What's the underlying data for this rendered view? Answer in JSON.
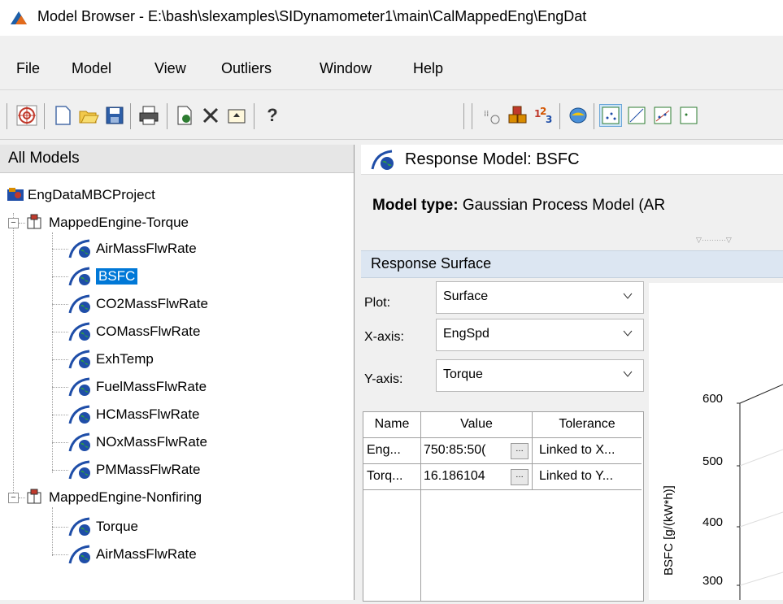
{
  "window": {
    "title": "Model Browser - E:\\bash\\slexamples\\SIDynamometer1\\main\\CalMappedEng\\EngDat"
  },
  "menu": [
    "File",
    "Model",
    "View",
    "Outliers",
    "Window",
    "Help"
  ],
  "toolbar": {
    "buttons": [
      "target-icon",
      "new-icon",
      "open-icon",
      "save-icon",
      "print-icon",
      "edit-doc-icon",
      "delete-icon",
      "up-folder-icon",
      "help-icon",
      "format-icon",
      "blocks-icon",
      "numbers-icon",
      "layers-icon",
      "scatter-view-icon",
      "diag-view-icon",
      "line-view-icon",
      "scatter-more-icon"
    ]
  },
  "tree": {
    "header": "All Models",
    "project": "EngDataMBCProject",
    "groups": [
      {
        "label": "MappedEngine-Torque",
        "children": [
          "AirMassFlwRate",
          "BSFC",
          "CO2MassFlwRate",
          "COMassFlwRate",
          "ExhTemp",
          "FuelMassFlwRate",
          "HCMassFlwRate",
          "NOxMassFlwRate",
          "PMMassFlwRate"
        ]
      },
      {
        "label": "MappedEngine-Nonfiring",
        "children": [
          "Torque",
          "AirMassFlwRate"
        ]
      }
    ],
    "selected": "BSFC"
  },
  "response": {
    "header": "Response Model: BSFC",
    "model_type_label": "Model type:",
    "model_type_value": "Gaussian Process Model (AR"
  },
  "surface": {
    "header": "Response Surface",
    "plot_label": "Plot:",
    "plot_value": "Surface",
    "x_label": "X-axis:",
    "x_value": "EngSpd",
    "y_label": "Y-axis:",
    "y_value": "Torque"
  },
  "table": {
    "columns": [
      "Name",
      "Value",
      "Tolerance"
    ],
    "rows": [
      [
        "Eng...",
        "750:85:50(",
        "Linked to X..."
      ],
      [
        "Torq...",
        "16.186104",
        "Linked to Y..."
      ]
    ]
  },
  "plot": {
    "ylabel": "BSFC [g/(kW*h)]",
    "yticks": [
      "600",
      "500",
      "400",
      "300"
    ]
  }
}
